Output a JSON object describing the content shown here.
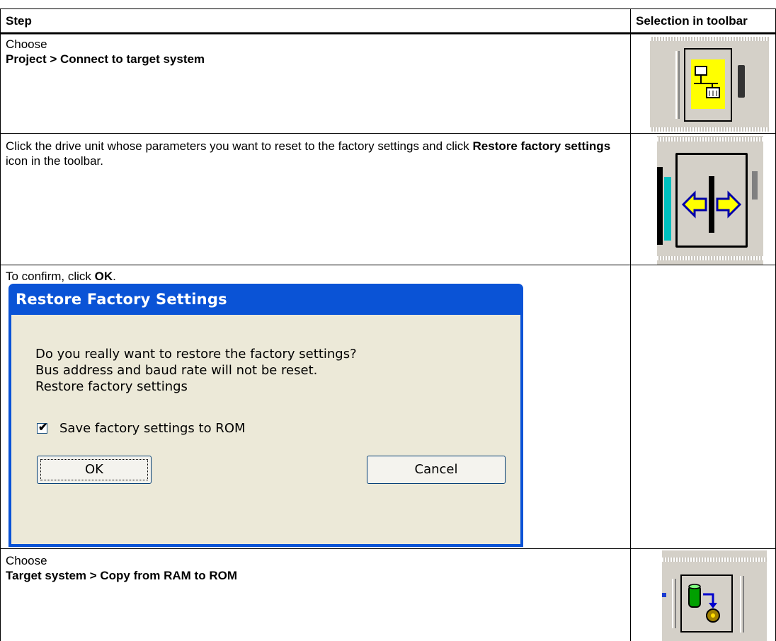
{
  "header": {
    "step": "Step",
    "selection": "Selection in toolbar"
  },
  "rows": [
    {
      "line1": "Choose",
      "line2": "Project > Connect to target system"
    },
    {
      "text_a": "Click the drive unit whose parameters you want to reset to the factory settings and click ",
      "bold": "Restore factory settings",
      "text_b": " icon in the toolbar."
    },
    {
      "text_a": "To confirm, click ",
      "bold": "OK",
      "text_b": "."
    },
    {
      "line1": "Choose",
      "line2": "Target system > Copy from RAM to ROM"
    }
  ],
  "dialog": {
    "title": "Restore Factory Settings",
    "message_lines": [
      "Do you really want to restore the factory settings?",
      "Bus address and baud rate will not be reset.",
      "Restore factory settings"
    ],
    "checkbox_label": "Save factory settings to ROM",
    "checkbox_checked": true,
    "ok_label": "OK",
    "cancel_label": "Cancel"
  },
  "icons": {
    "row1": "connect-target-icon",
    "row2": "restore-factory-settings-icon",
    "row4": "copy-ram-to-rom-icon"
  },
  "colors": {
    "dialog_title_bar": "#0a53d6",
    "dialog_body": "#ece9d8",
    "toolbar": "#d4d0c8",
    "connect_highlight": "#ffff00"
  }
}
